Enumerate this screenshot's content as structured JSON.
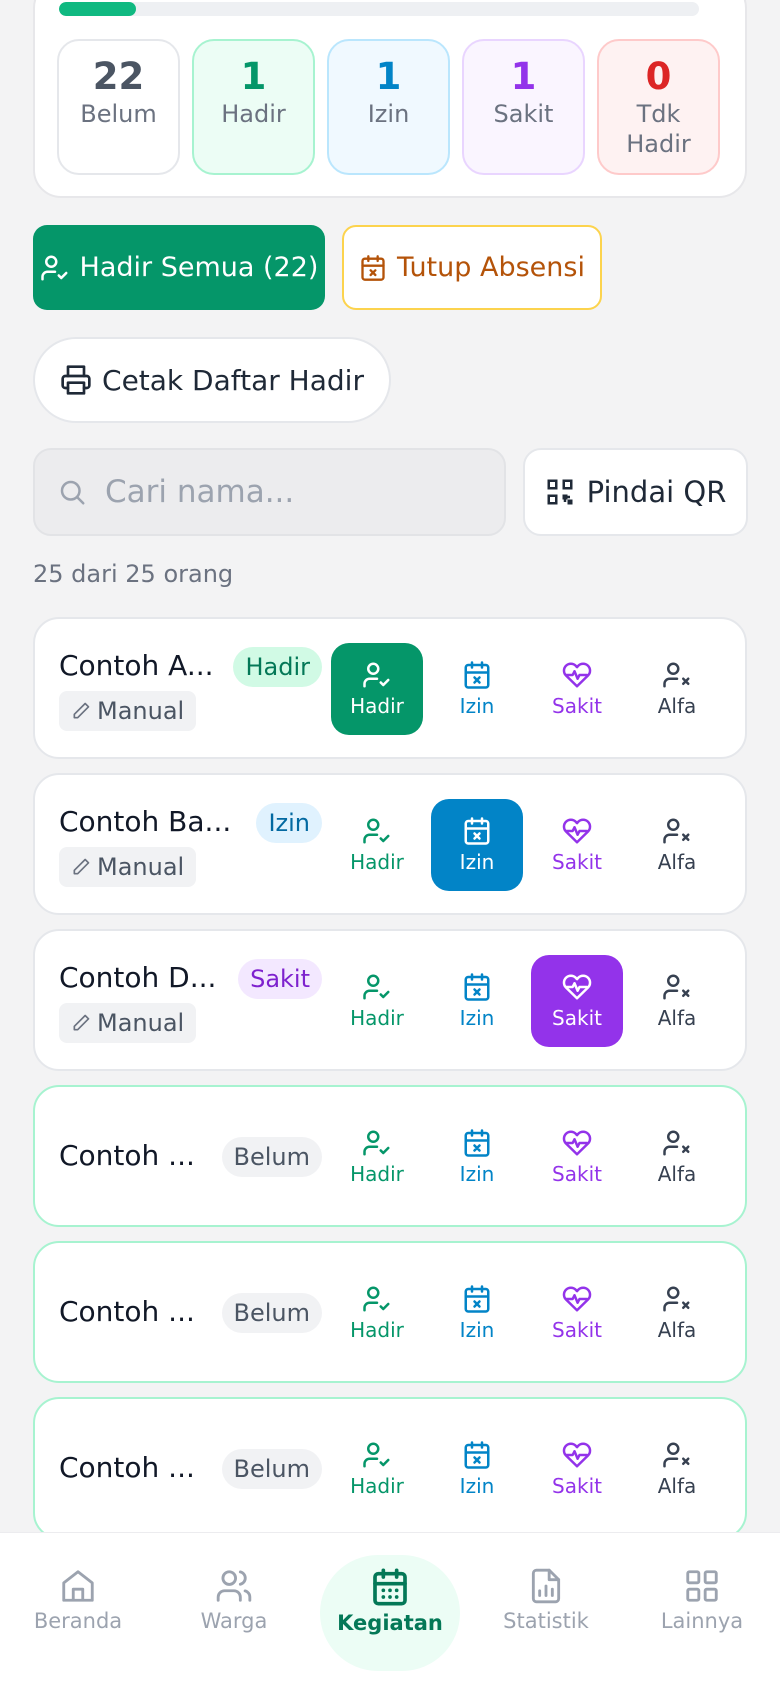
{
  "progress": {
    "fill_percent": 12
  },
  "stats": [
    {
      "value": "22",
      "label": "Belum",
      "color": "#4b5563",
      "bg": "#ffffff",
      "border": "#e5e7eb"
    },
    {
      "value": "1",
      "label": "Hadir",
      "color": "#059669",
      "bg": "#ecfdf5",
      "border": "#a7f3d0"
    },
    {
      "value": "1",
      "label": "Izin",
      "color": "#0284c7",
      "bg": "#f0f9ff",
      "border": "#bae6fd"
    },
    {
      "value": "1",
      "label": "Sakit",
      "color": "#9333ea",
      "bg": "#faf5ff",
      "border": "#e9d5ff"
    },
    {
      "value": "0",
      "label": "Tdk Hadir",
      "color": "#dc2626",
      "bg": "#fef2f2",
      "border": "#fecaca"
    }
  ],
  "actions": {
    "hadir_semua": "Hadir Semua (22)",
    "tutup_absensi": "Tutup Absensi",
    "cetak": "Cetak Daftar Hadir"
  },
  "search": {
    "placeholder": "Cari nama...",
    "qr_label": "Pindai QR"
  },
  "count_text": "25 dari 25 orang",
  "options": {
    "hadir": "Hadir",
    "izin": "Izin",
    "sakit": "Sakit",
    "alfa": "Alfa"
  },
  "people": [
    {
      "name": "Contoh A...",
      "status": "Hadir",
      "source": "Manual"
    },
    {
      "name": "Contoh Ba...",
      "status": "Izin",
      "source": "Manual"
    },
    {
      "name": "Contoh D...",
      "status": "Sakit",
      "source": "Manual"
    },
    {
      "name": "Contoh ...",
      "status": "Belum"
    },
    {
      "name": "Contoh ...",
      "status": "Belum"
    },
    {
      "name": "Contoh ...",
      "status": "Belum"
    }
  ],
  "nav": {
    "beranda": "Beranda",
    "warga": "Warga",
    "kegiatan": "Kegiatan",
    "statistik": "Statistik",
    "lainnya": "Lainnya",
    "active": "Kegiatan"
  },
  "colors": {
    "primary": "#059669",
    "izin": "#0284c7",
    "sakit": "#9333ea",
    "alfa": "#374151",
    "warning": "#b45309"
  }
}
